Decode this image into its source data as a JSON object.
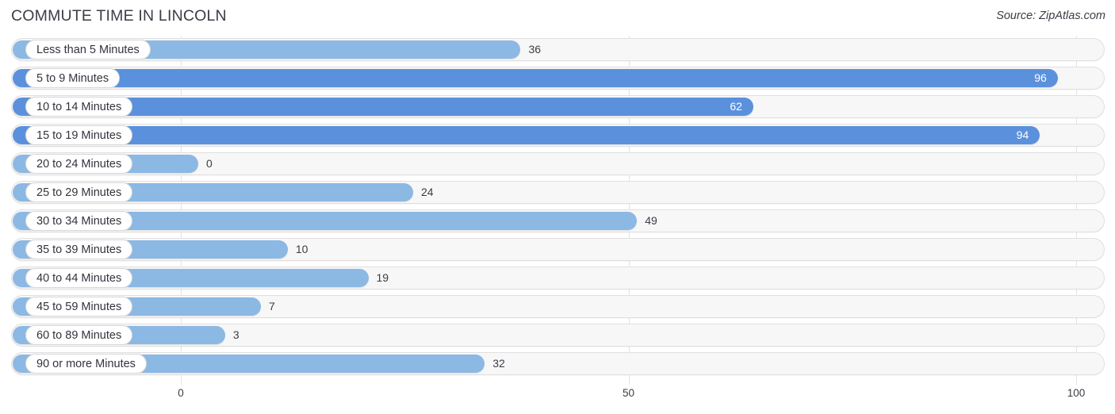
{
  "header": {
    "title": "COMMUTE TIME IN LINCOLN",
    "source": "Source: ZipAtlas.com"
  },
  "chart_data": {
    "type": "bar",
    "orientation": "horizontal",
    "title": "COMMUTE TIME IN LINCOLN",
    "xlabel": "",
    "ylabel": "",
    "xlim": [
      0,
      100
    ],
    "xticks": [
      0,
      50,
      100
    ],
    "xtick_labels": [
      "0",
      "50",
      "100"
    ],
    "grid": true,
    "legend": false,
    "categories": [
      "Less than 5 Minutes",
      "5 to 9 Minutes",
      "10 to 14 Minutes",
      "15 to 19 Minutes",
      "20 to 24 Minutes",
      "25 to 29 Minutes",
      "30 to 34 Minutes",
      "35 to 39 Minutes",
      "40 to 44 Minutes",
      "45 to 59 Minutes",
      "60 to 89 Minutes",
      "90 or more Minutes"
    ],
    "values": [
      36,
      96,
      62,
      94,
      0,
      24,
      49,
      10,
      19,
      7,
      3,
      32
    ],
    "value_labels": [
      "36",
      "96",
      "62",
      "94",
      "0",
      "24",
      "49",
      "10",
      "19",
      "7",
      "3",
      "32"
    ],
    "label_placement": [
      "outside",
      "inside",
      "inside",
      "inside",
      "outside",
      "outside",
      "outside",
      "outside",
      "outside",
      "outside",
      "outside",
      "outside"
    ],
    "colors": {
      "bar_light": "#8cb8e4",
      "bar_dark": "#5b91dc",
      "track": "#f7f7f7",
      "track_border": "#e0e0e0",
      "gridline": "#e3e3e3",
      "text": "#3c3c46",
      "value_inside_text": "#ffffff"
    }
  }
}
